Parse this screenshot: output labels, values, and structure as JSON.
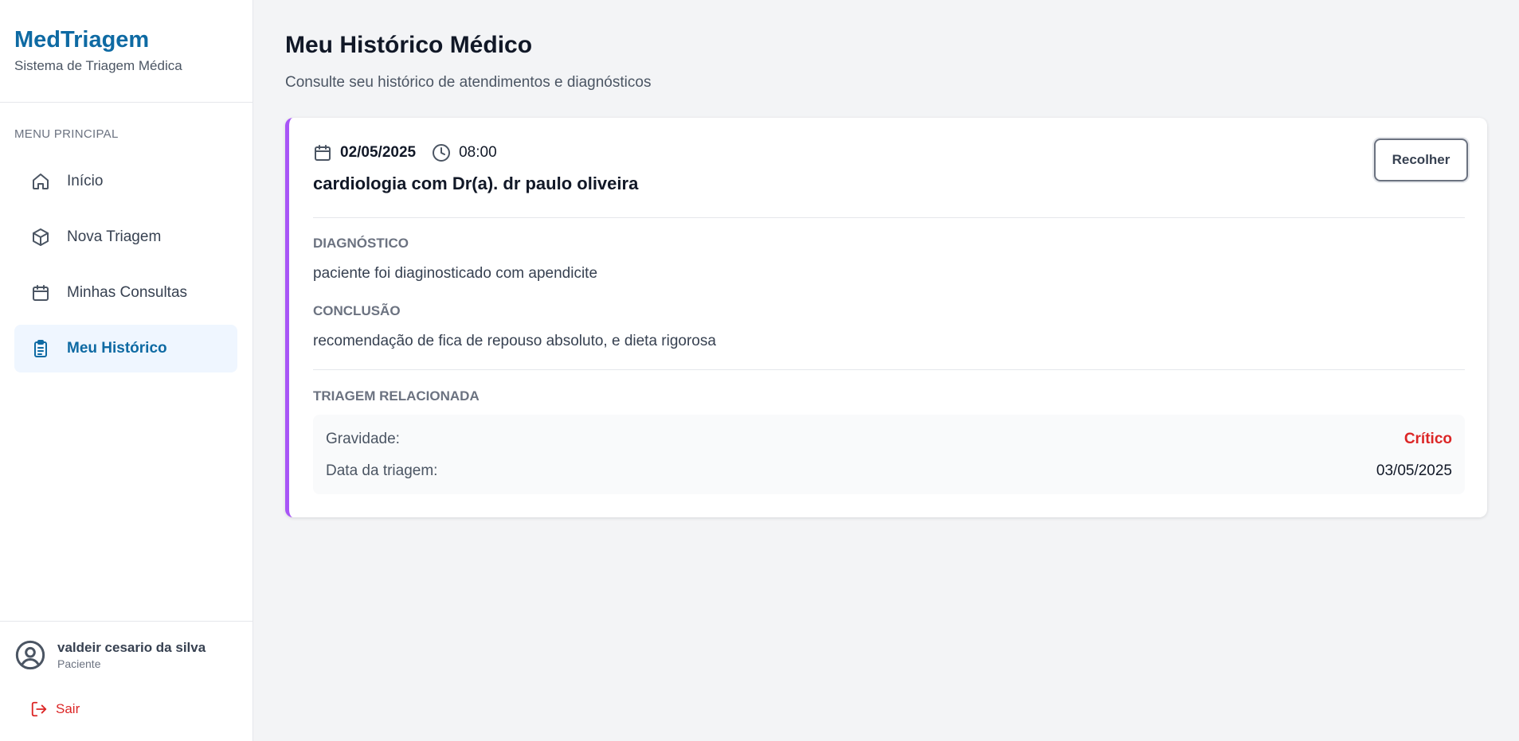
{
  "brand": {
    "title": "MedTriagem",
    "subtitle": "Sistema de Triagem Médica"
  },
  "menu": {
    "heading": "MENU PRINCIPAL",
    "items": [
      {
        "label": "Início",
        "icon": "home-icon"
      },
      {
        "label": "Nova Triagem",
        "icon": "cube-icon"
      },
      {
        "label": "Minhas Consultas",
        "icon": "calendar-icon"
      },
      {
        "label": "Meu Histórico",
        "icon": "clipboard-icon",
        "active": true
      }
    ]
  },
  "user": {
    "name": "valdeir cesario da silva",
    "role": "Paciente",
    "logout_label": "Sair"
  },
  "page": {
    "title": "Meu Histórico Médico",
    "subtitle": "Consulte seu histórico de atendimentos e diagnósticos"
  },
  "record": {
    "date": "02/05/2025",
    "time": "08:00",
    "title": "cardiologia com Dr(a). dr paulo oliveira",
    "toggle_label": "Recolher",
    "diagnosis_label": "DIAGNÓSTICO",
    "diagnosis": "paciente foi diaginosticado com apendicite",
    "conclusion_label": "CONCLUSÃO",
    "conclusion": "recomendação de fica de repouso absoluto, e dieta rigorosa",
    "triage_label": "TRIAGEM RELACIONADA",
    "triage": {
      "severity_label": "Gravidade:",
      "severity_value": "Crítico",
      "date_label": "Data da triagem:",
      "date_value": "03/05/2025"
    }
  },
  "colors": {
    "brand": "#0e6aa3",
    "accent_border": "#a855f7",
    "critical": "#dc2626",
    "logout": "#dc2626"
  }
}
